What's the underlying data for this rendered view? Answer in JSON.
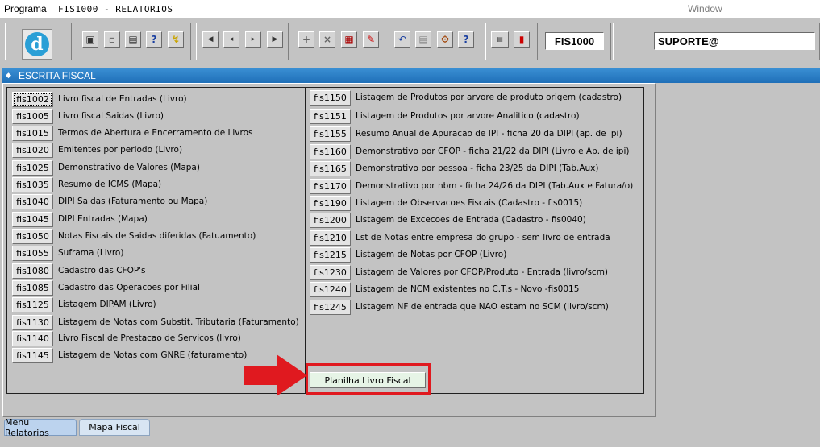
{
  "menubar": {
    "programa": "Programa",
    "title": "FIS1000 - RELATORIOS",
    "window": "Window"
  },
  "toolbar": {
    "logo_letter": "d",
    "program_code": "FIS1000",
    "user": "SUPORTE@",
    "icons": [
      "save-icon",
      "window-icon",
      "print-icon",
      "query-help-icon",
      "execute-query-icon",
      "first-record-icon",
      "previous-record-icon",
      "next-record-icon",
      "last-record-icon",
      "insert-record-icon",
      "delete-record-icon",
      "print-preview-icon",
      "edit-icon",
      "undo-icon",
      "clipboard-icon",
      "tools-icon",
      "help-icon",
      "menu-icon",
      "exit-icon"
    ]
  },
  "window": {
    "title": "ESCRITA FISCAL"
  },
  "left_items": [
    {
      "code": "fis1002",
      "label": "Livro fiscal de Entradas (Livro)"
    },
    {
      "code": "fis1005",
      "label": "Livro fiscal Saidas (Livro)"
    },
    {
      "code": "fis1015",
      "label": "Termos de Abertura e  Encerramento de Livros"
    },
    {
      "code": "fis1020",
      "label": "Emitentes por periodo (Livro)"
    },
    {
      "code": "fis1025",
      "label": "Demonstrativo de Valores (Mapa)"
    },
    {
      "code": "fis1035",
      "label": "Resumo de ICMS (Mapa)"
    },
    {
      "code": "fis1040",
      "label": "DIPI Saidas (Faturamento ou Mapa)"
    },
    {
      "code": "fis1045",
      "label": "DIPI Entradas (Mapa)"
    },
    {
      "code": "fis1050",
      "label": "Notas Fiscais de Saidas diferidas (Fatuamento)"
    },
    {
      "code": "fis1055",
      "label": "Suframa (Livro)"
    },
    {
      "code": "fis1080",
      "label": "Cadastro das CFOP's"
    },
    {
      "code": "fis1085",
      "label": "Cadastro das Operacoes por Filial"
    },
    {
      "code": "fis1125",
      "label": "Listagem DIPAM (Livro)"
    },
    {
      "code": "fis1130",
      "label": "Listagem de Notas com Substit. Tributaria (Faturamento)"
    },
    {
      "code": "fis1140",
      "label": "Livro Fiscal de Prestacao de Servicos (livro)"
    },
    {
      "code": "fis1145",
      "label": "Listagem de Notas com GNRE (faturamento)"
    }
  ],
  "right_items": [
    {
      "code": "fis1150",
      "label": "Listagem de Produtos por arvore de produto origem (cadastro)"
    },
    {
      "code": "fis1151",
      "label": "Listagem de Produtos por arvore Analitico (cadastro)"
    },
    {
      "code": "fis1155",
      "label": "Resumo Anual de Apuracao de IPI - ficha 20 da DIPI  (ap. de ipi)"
    },
    {
      "code": "fis1160",
      "label": "Demonstrativo por CFOP - ficha 21/22 da DIPI  (Livro e Ap. de ipi)"
    },
    {
      "code": "fis1165",
      "label": "Demonstrativo por pessoa - ficha 23/25 da DIPI  (Tab.Aux)"
    },
    {
      "code": "fis1170",
      "label": "Demonstrativo por nbm - ficha 24/26 da DIPI  (Tab.Aux e Fatura/o)"
    },
    {
      "code": "fis1190",
      "label": "Listagem de Observacoes Fiscais  (Cadastro - fis0015)"
    },
    {
      "code": "fis1200",
      "label": "Listagem de Excecoes de Entrada  (Cadastro - fis0040)"
    },
    {
      "code": "fis1210",
      "label": "Lst de Notas entre empresa do grupo - sem  livro de entrada"
    },
    {
      "code": "fis1215",
      "label": "Listagem de Notas por CFOP (Livro)"
    },
    {
      "code": "fis1230",
      "label": "Listagem de Valores por CFOP/Produto - Entrada  (livro/scm)"
    },
    {
      "code": "fis1240",
      "label": "Listagem de NCM existentes no C.T.s - Novo -fis0015"
    },
    {
      "code": "fis1245",
      "label": "Listagem  NF de entrada que NAO estam no SCM (livro/scm)"
    }
  ],
  "planilha_button": "Planilha Livro Fiscal",
  "tabs": [
    {
      "label": "Menu Relatorios",
      "active": true
    },
    {
      "label": "Mapa Fiscal",
      "active": false
    }
  ],
  "colors": {
    "highlight_red": "#e0191f",
    "title_blue": "#1f6fb8"
  }
}
